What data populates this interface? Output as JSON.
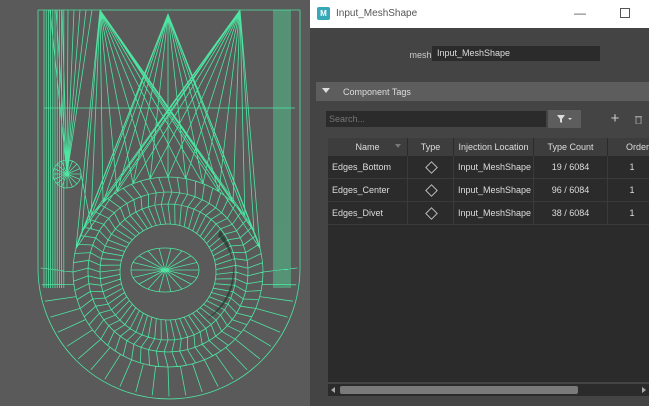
{
  "window": {
    "title": "Input_MeshShape",
    "app_icon": "M"
  },
  "mesh": {
    "label": "mesh:",
    "value": "Input_MeshShape"
  },
  "section": {
    "label": "Component Tags"
  },
  "search": {
    "placeholder": "Search..."
  },
  "table": {
    "columns": [
      "Name",
      "Type",
      "Injection Location",
      "Type Count",
      "Order"
    ],
    "rows": [
      {
        "name": "Edges_Bottom",
        "injection": "Input_MeshShape",
        "count": "19 / 6084",
        "order": "1"
      },
      {
        "name": "Edges_Center",
        "injection": "Input_MeshShape",
        "count": "96 / 6084",
        "order": "1"
      },
      {
        "name": "Edges_Divet",
        "injection": "Input_MeshShape",
        "count": "38 / 6084",
        "order": "1"
      }
    ]
  },
  "icons": {
    "app": "maya-icon",
    "minimize": "minimize-icon",
    "maximize": "maximize-icon",
    "filter": "filter-icon",
    "add": "plus-icon",
    "delete": "trash-icon",
    "type": "diamond-icon"
  },
  "colors": {
    "wireframe": "#4ee5a2",
    "panel_bg": "#444444",
    "field_bg": "#2b2b2b",
    "viewport_bg": "#5a5a5a"
  }
}
